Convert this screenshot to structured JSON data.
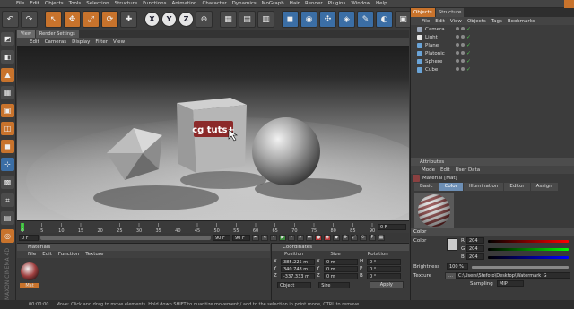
{
  "menubar": [
    "File",
    "Edit",
    "Objects",
    "Tools",
    "Selection",
    "Structure",
    "Functions",
    "Animation",
    "Character",
    "Dynamics",
    "MoGraph",
    "Hair",
    "Render",
    "Plugins",
    "Window",
    "Help"
  ],
  "toolbar": {
    "axis": [
      "X",
      "Y",
      "Z"
    ]
  },
  "viewport": {
    "tabs": [
      "View",
      "Render Settings"
    ],
    "menu": [
      "Edit",
      "Cameras",
      "Display",
      "Filter",
      "View"
    ],
    "watermark": "cg tuts+"
  },
  "timeline": {
    "ticks": [
      "0",
      "5",
      "10",
      "15",
      "20",
      "25",
      "30",
      "35",
      "40",
      "45",
      "50",
      "55",
      "60",
      "65",
      "70",
      "75",
      "80",
      "85",
      "90"
    ],
    "current": "0 F",
    "start": "0 F",
    "end": "90 F",
    "end2": "90 F"
  },
  "materials": {
    "title": "Materials",
    "menu": [
      "File",
      "Edit",
      "Function",
      "Texture"
    ],
    "item": "Mat"
  },
  "coordinates": {
    "title": "Coordinates",
    "headers": [
      "Position",
      "Size",
      "Rotation"
    ],
    "rows": [
      {
        "axis": "X",
        "pos": "385.225 m",
        "size_axis": "X",
        "size": "0 m",
        "rot_axis": "H",
        "rot": "0 °"
      },
      {
        "axis": "Y",
        "pos": "340.748 m",
        "size_axis": "Y",
        "size": "0 m",
        "rot_axis": "P",
        "rot": "0 °"
      },
      {
        "axis": "Z",
        "pos": "-337.333 m",
        "size_axis": "Z",
        "size": "0 m",
        "rot_axis": "B",
        "rot": "0 °"
      }
    ],
    "mode": "Object",
    "size_mode": "Size",
    "apply": "Apply"
  },
  "status": {
    "time": "00:00:00",
    "message": "Move: Click and drag to move elements. Hold down SHIFT to quantize movement / add to the selection in point mode, CTRL to remove.",
    "brand": "MAXON CINEMA 4D"
  },
  "objects_panel": {
    "tabs": [
      "Objects",
      "Structure"
    ],
    "menu": [
      "File",
      "Edit",
      "View",
      "Objects",
      "Tags",
      "Bookmarks"
    ],
    "items": [
      {
        "name": "Camera",
        "color": "#9aa6b8"
      },
      {
        "name": "Light",
        "color": "#e8e8e8"
      },
      {
        "name": "Plane",
        "color": "#6aa4d8"
      },
      {
        "name": "Platonic",
        "color": "#6aa4d8"
      },
      {
        "name": "Sphere",
        "color": "#6aa4d8"
      },
      {
        "name": "Cube",
        "color": "#6aa4d8"
      }
    ]
  },
  "attributes": {
    "title": "Attributes",
    "menu": [
      "Mode",
      "Edit",
      "User Data"
    ],
    "material_label": "Material [Mat]",
    "tabs": [
      "Basic",
      "Color",
      "Illumination",
      "Editor",
      "Assign"
    ],
    "active_tab": "Color",
    "section": "Color",
    "color_label": "Color",
    "r_label": "R",
    "r_value": "204",
    "g_label": "G",
    "g_value": "204",
    "b_label": "B",
    "b_value": "204",
    "brightness_label": "Brightness",
    "brightness_value": "100 %",
    "texture_label": "Texture",
    "texture_path": "C:\\Users\\Stefoto\\Desktop\\Watermark_G",
    "sampling_label": "Sampling",
    "sampling_value": "MIP"
  },
  "colors": {
    "accent": "#c8732c",
    "selected_tab": "#6d8fb5"
  }
}
